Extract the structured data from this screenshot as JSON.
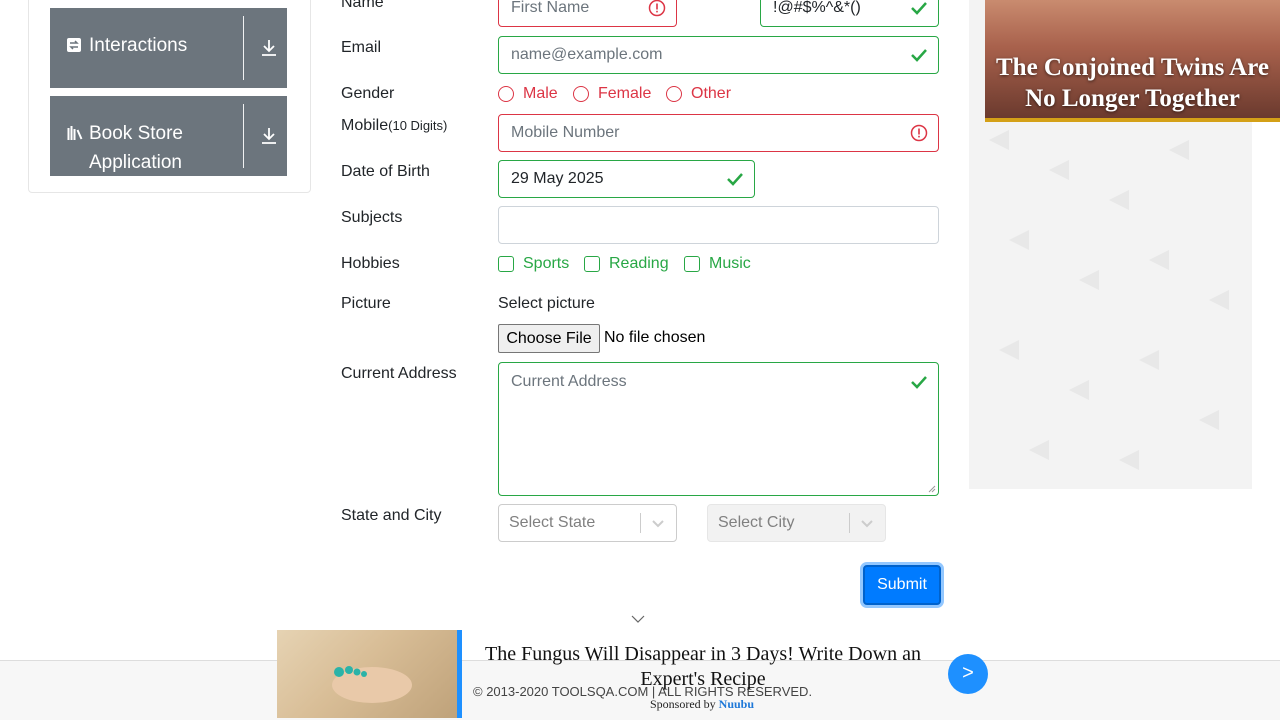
{
  "sidebar": {
    "groups": [
      {
        "label": "Interactions",
        "icon": "swap-icon"
      },
      {
        "label_line1": "Book Store",
        "label_line2": "Application",
        "icon": "books-icon"
      }
    ]
  },
  "form": {
    "name": {
      "label": "Name",
      "first_placeholder": "First Name",
      "last_value": "!@#$%^&*()"
    },
    "email": {
      "label": "Email",
      "placeholder": "name@example.com"
    },
    "gender": {
      "label": "Gender",
      "options": [
        "Male",
        "Female",
        "Other"
      ]
    },
    "mobile": {
      "label": "Mobile",
      "hint": "(10 Digits)",
      "placeholder": "Mobile Number"
    },
    "dob": {
      "label": "Date of Birth",
      "value": "29 May 2025"
    },
    "subjects": {
      "label": "Subjects",
      "value": ""
    },
    "hobbies": {
      "label": "Hobbies",
      "options": [
        "Sports",
        "Reading",
        "Music"
      ]
    },
    "picture": {
      "label": "Picture",
      "prompt": "Select picture",
      "button": "Choose File",
      "status": "No file chosen"
    },
    "address": {
      "label": "Current Address",
      "placeholder": "Current Address"
    },
    "state_city": {
      "label": "State and City",
      "state_placeholder": "Select State",
      "city_placeholder": "Select City"
    },
    "submit": "Submit"
  },
  "ads": {
    "right_title": "The Conjoined Twins Are No Longer Together",
    "bottom_headline": "The Fungus Will Disappear in 3 Days! Write Down an Expert's Recipe",
    "sponsored_prefix": "Sponsored by",
    "sponsor": "Nuubu",
    "next_label": ">"
  },
  "footer": {
    "copyright": "© 2013-2020 TOOLSQA.COM | ALL RIGHTS RESERVED."
  },
  "colors": {
    "valid": "#28a745",
    "invalid": "#dc3545",
    "primary": "#007bff",
    "sidebar": "#6c757d"
  }
}
